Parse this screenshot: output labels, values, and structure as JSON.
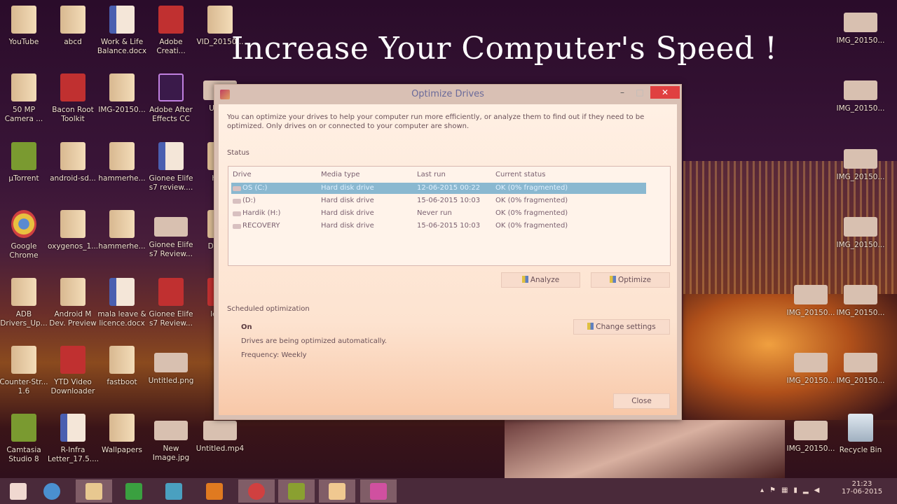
{
  "headline": "Increase Your Computer's Speed !",
  "desktop_icons": [
    {
      "label": "YouTube",
      "type": "folder"
    },
    {
      "label": "abcd",
      "type": "folder"
    },
    {
      "label": "Work & Life Balance.docx",
      "type": "word"
    },
    {
      "label": "Adobe Creati...",
      "type": "app"
    },
    {
      "label": "VID_20150...",
      "type": "folder"
    },
    {
      "label": "50 MP Camera ...",
      "type": "folder"
    },
    {
      "label": "Bacon Root Toolkit",
      "type": "app"
    },
    {
      "label": "IMG-20150...",
      "type": "folder"
    },
    {
      "label": "Adobe After Effects CC",
      "type": "ae"
    },
    {
      "label": "Unti...",
      "type": "img"
    },
    {
      "label": "µTorrent",
      "type": "green"
    },
    {
      "label": "android-sd...",
      "type": "folder"
    },
    {
      "label": "hammerhe...",
      "type": "folder"
    },
    {
      "label": "Gionee Elife s7 review....",
      "type": "word"
    },
    {
      "label": "he...",
      "type": "folder"
    },
    {
      "label": "Google Chrome",
      "type": "chrome"
    },
    {
      "label": "oxygenos_1...",
      "type": "folder"
    },
    {
      "label": "hammerhe...",
      "type": "folder"
    },
    {
      "label": "Gionee Elife s7 Review...",
      "type": "img"
    },
    {
      "label": "Dem...",
      "type": "folder"
    },
    {
      "label": "ADB Drivers_Up...",
      "type": "folder"
    },
    {
      "label": "Android M Dev. Preview",
      "type": "folder"
    },
    {
      "label": "mala leave & licence.docx",
      "type": "word"
    },
    {
      "label": "Gionee Elife s7 Review...",
      "type": "app"
    },
    {
      "label": "lett...",
      "type": "app"
    },
    {
      "label": "Counter-Str... 1.6",
      "type": "folder"
    },
    {
      "label": "YTD Video Downloader",
      "type": "app"
    },
    {
      "label": "fastboot",
      "type": "folder"
    },
    {
      "label": "Untitled.png",
      "type": "img"
    },
    {
      "label": "",
      "type": "none"
    },
    {
      "label": "Camtasia Studio 8",
      "type": "green"
    },
    {
      "label": "R-Infra Letter_17.5....",
      "type": "word"
    },
    {
      "label": "Wallpapers",
      "type": "folder"
    },
    {
      "label": "New Image.jpg",
      "type": "img"
    },
    {
      "label": "Untitled.mp4",
      "type": "img"
    }
  ],
  "right_icons": [
    {
      "label": "IMG_20150...",
      "type": "img"
    },
    {
      "label": "IMG_20150...",
      "type": "img"
    },
    {
      "label": "IMG_20150...",
      "type": "img"
    },
    {
      "label": "IMG_20150...",
      "type": "img"
    },
    {
      "label": "IMG_20150...",
      "type": "img"
    },
    {
      "label": "IMG_20150...",
      "type": "img"
    },
    {
      "label": "IMG_20150...",
      "type": "img"
    },
    {
      "label": "IMG_20150...",
      "type": "img"
    },
    {
      "label": "IMG_20150...",
      "type": "img"
    },
    {
      "label": "Recycle Bin",
      "type": "bin"
    }
  ],
  "window": {
    "title": "Optimize Drives",
    "minimize": "–",
    "maximize": "□",
    "close": "✕",
    "description": "You can optimize your drives to help your computer run more efficiently, or analyze them to find out if they need to be optimized. Only drives on or connected to your computer are shown.",
    "status_label": "Status",
    "columns": [
      "Drive",
      "Media type",
      "Last run",
      "Current status"
    ],
    "drives": [
      {
        "drive": "OS (C:)",
        "media": "Hard disk drive",
        "last_run": "12-06-2015 00:22",
        "status": "OK (0% fragmented)",
        "selected": true
      },
      {
        "drive": "(D:)",
        "media": "Hard disk drive",
        "last_run": "15-06-2015 10:03",
        "status": "OK (0% fragmented)"
      },
      {
        "drive": "Hardik  (H:)",
        "media": "Hard disk drive",
        "last_run": "Never run",
        "status": "OK (0% fragmented)"
      },
      {
        "drive": "RECOVERY",
        "media": "Hard disk drive",
        "last_run": "15-06-2015 10:03",
        "status": "OK (0% fragmented)"
      }
    ],
    "analyze": "Analyze",
    "optimize": "Optimize",
    "scheduled_label": "Scheduled optimization",
    "schedule_state": "On",
    "schedule_desc": "Drives are being optimized automatically.",
    "frequency": "Frequency: Weekly",
    "change_settings": "Change settings",
    "close_button": "Close"
  },
  "taskbar": {
    "items": [
      {
        "name": "start",
        "color": "#f0d8d0"
      },
      {
        "name": "internet-explorer",
        "color": "#4a90d0"
      },
      {
        "name": "file-explorer",
        "color": "#e8c890",
        "active": true
      },
      {
        "name": "store",
        "color": "#3aa040"
      },
      {
        "name": "media-player",
        "color": "#4aa0c0"
      },
      {
        "name": "vlc",
        "color": "#e07a20"
      },
      {
        "name": "chrome",
        "color": "#d04040",
        "active": true
      },
      {
        "name": "camtasia",
        "color": "#8aa030",
        "active": true
      },
      {
        "name": "camtasia-recorder",
        "color": "#f0c890",
        "active": true
      },
      {
        "name": "app",
        "color": "#d050a0",
        "active": true
      }
    ],
    "time": "21:23",
    "date": "17-06-2015"
  }
}
